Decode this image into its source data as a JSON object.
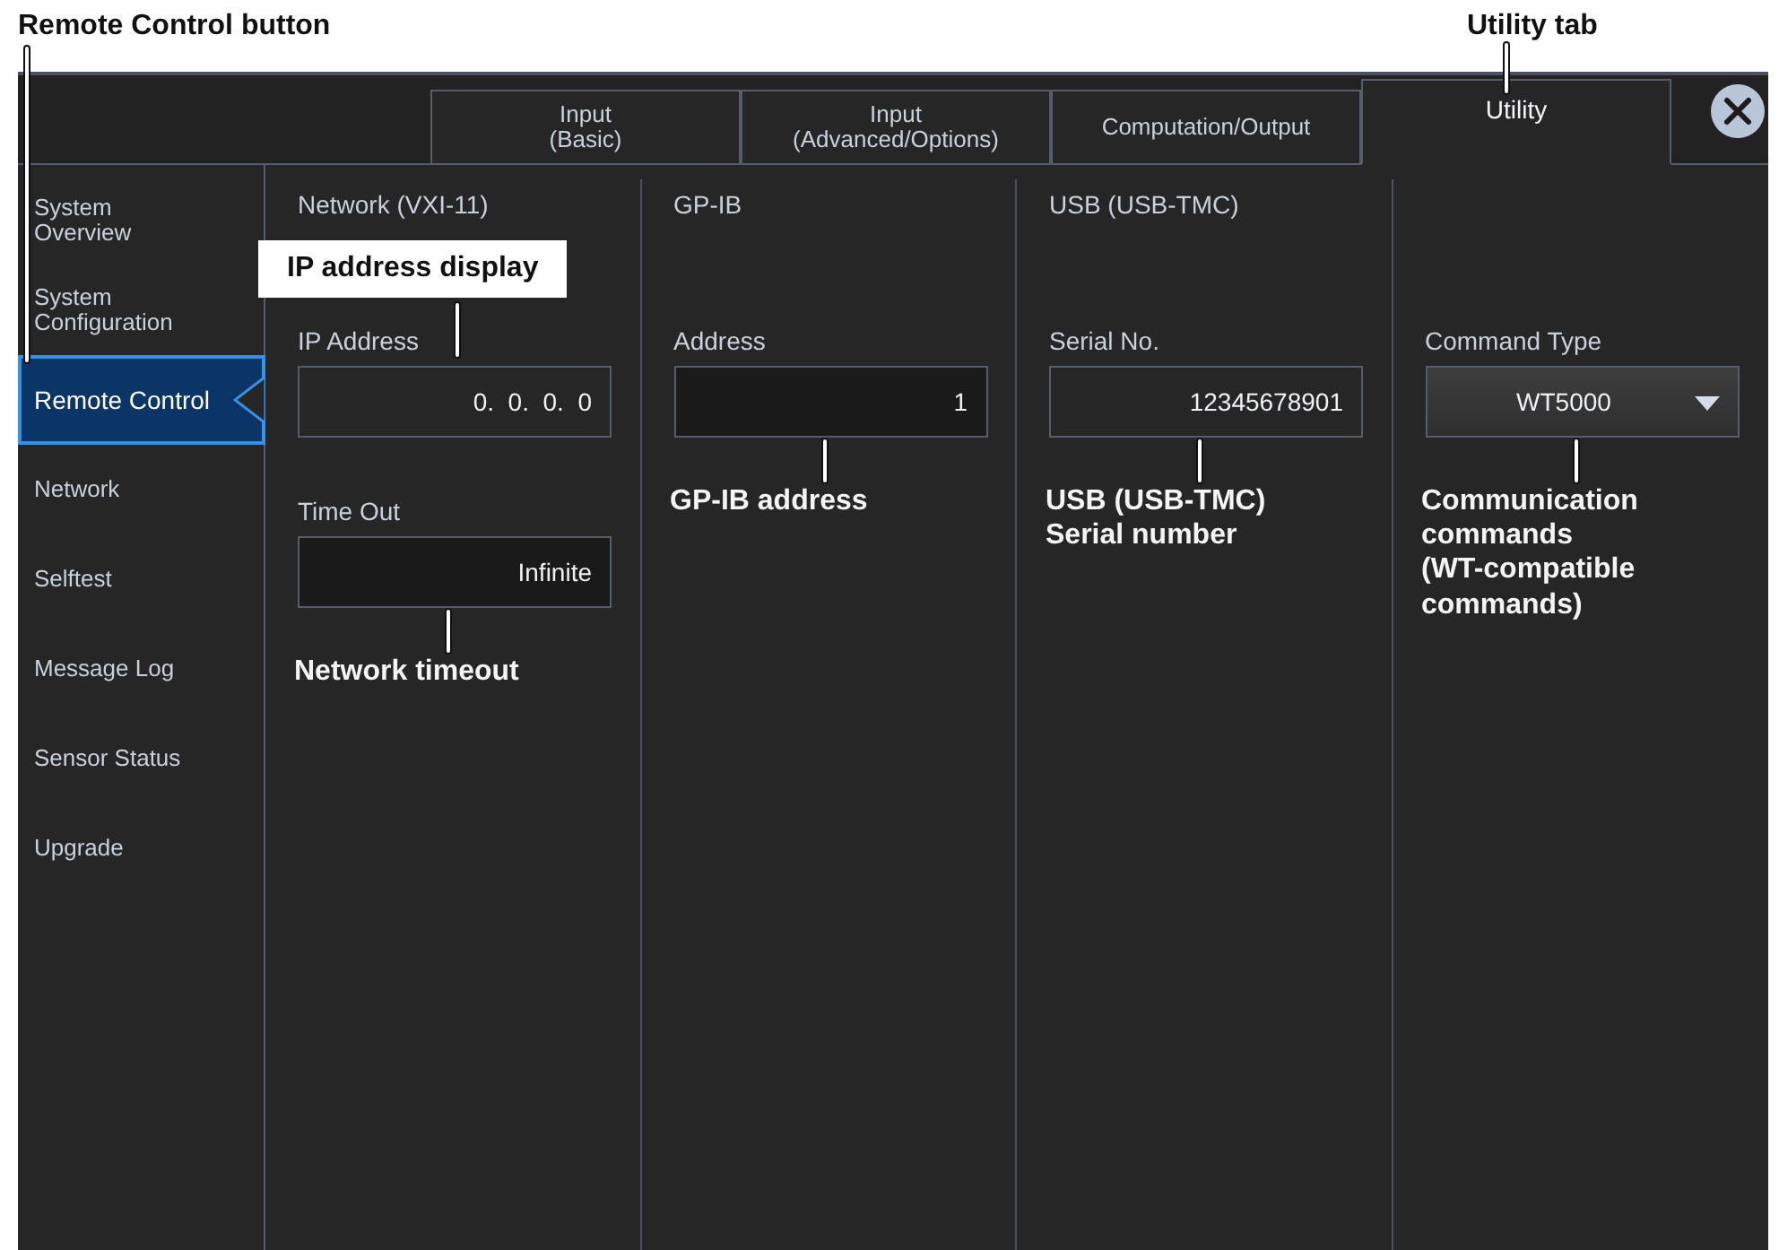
{
  "callouts": {
    "sidebar": "Remote Control button",
    "tab": "Utility tab"
  },
  "tabs": [
    {
      "label": "Input\n(Basic)",
      "selected": false
    },
    {
      "label": "Input\n(Advanced/Options)",
      "selected": false
    },
    {
      "label": "Computation/Output",
      "selected": false
    },
    {
      "label": "Utility",
      "selected": true
    }
  ],
  "sidebar": {
    "items": [
      {
        "label": "System\nOverview",
        "selected": false
      },
      {
        "label": "System\nConfiguration",
        "selected": false
      },
      {
        "label": "Remote Control",
        "selected": true
      },
      {
        "label": "Network",
        "selected": false
      },
      {
        "label": "Selftest",
        "selected": false
      },
      {
        "label": "Message Log",
        "selected": false
      },
      {
        "label": "Sensor Status",
        "selected": false
      },
      {
        "label": "Upgrade",
        "selected": false
      }
    ]
  },
  "columns": [
    {
      "heading": "Network (VXI-11)",
      "fields": [
        {
          "label": "IP Address",
          "value": "0.  0.  0.  0",
          "kind": "display",
          "callout": {
            "text": "IP address display",
            "kind": "above"
          }
        },
        {
          "label": "Time Out",
          "value": "Infinite",
          "kind": "input",
          "callout": {
            "text": "Network timeout",
            "kind": "below"
          }
        }
      ]
    },
    {
      "heading": "GP-IB",
      "fields": [
        {
          "label": "Address",
          "value": "1",
          "kind": "input",
          "callout": {
            "text": "GP-IB address",
            "kind": "below"
          }
        }
      ]
    },
    {
      "heading": "USB (USB-TMC)",
      "fields": [
        {
          "label": "Serial No.",
          "value": "12345678901",
          "kind": "display",
          "callout": {
            "text": "USB (USB-TMC)\nSerial number",
            "kind": "below"
          }
        }
      ]
    },
    {
      "fields": [
        {
          "label": "Command Type",
          "value": "WT5000",
          "kind": "dropdown",
          "callout": {
            "text": "Communication\ncommands\n(WT-compatible\ncommands)",
            "kind": "below"
          }
        }
      ]
    }
  ]
}
